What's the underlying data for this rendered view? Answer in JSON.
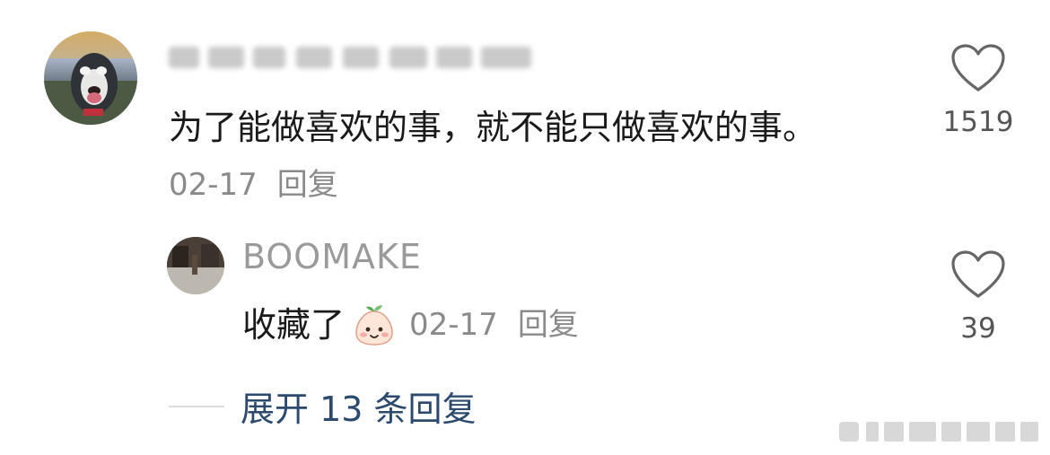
{
  "comment": {
    "username_blurred": true,
    "text": "为了能做喜欢的事，就不能只做喜欢的事。",
    "date": "02-17",
    "reply_label": "回复",
    "likes": "1519"
  },
  "reply": {
    "username": "BOOMAKE",
    "text": "收藏了",
    "emoji": "blushing-face-emoji",
    "date": "02-17",
    "reply_label": "回复",
    "likes": "39"
  },
  "expand": {
    "label": "展开 13 条回复"
  },
  "colors": {
    "link": "#2c4a6e",
    "meta": "#8a8a8a",
    "text": "#1a1a1a"
  }
}
